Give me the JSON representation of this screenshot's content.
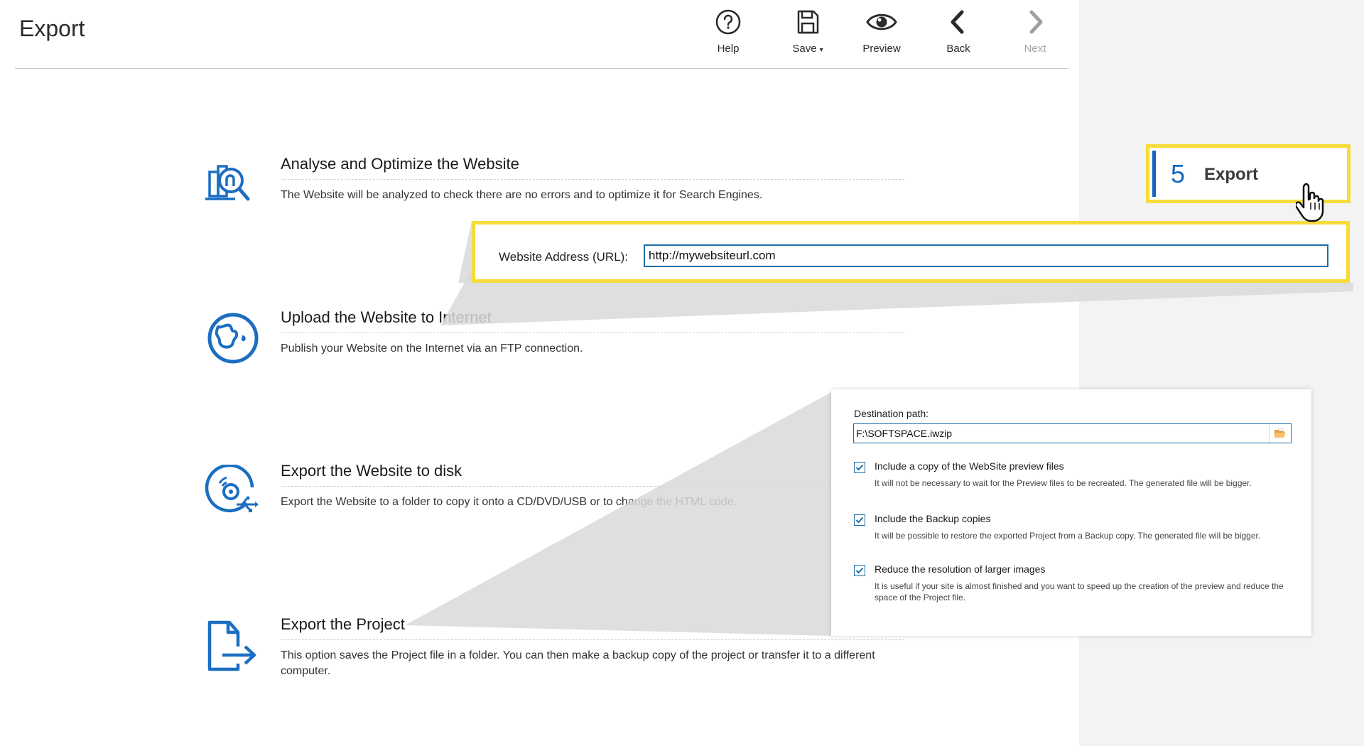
{
  "page": {
    "title": "Export"
  },
  "toolbar": {
    "help_label": "Help",
    "save_label": "Save",
    "save_caret": "▾",
    "preview_label": "Preview",
    "back_label": "Back",
    "next_label": "Next"
  },
  "options": [
    {
      "title": "Analyse and Optimize the Website",
      "description": "The Website will be analyzed to check there are no errors and to optimize it for Search Engines.",
      "icon": "analyse-icon"
    },
    {
      "title": "Upload the Website to Internet",
      "description": "Publish your Website on the Internet via an FTP connection.",
      "icon": "globe-icon"
    },
    {
      "title": "Export the Website to disk",
      "description": "Export the Website to a folder to copy it onto a CD/DVD/USB or to change the HTML code.",
      "icon": "disc-usb-icon"
    },
    {
      "title": "Export the Project",
      "description": "This option saves the Project file in a folder.  You can then make a backup copy of the project or transfer it to a different computer.",
      "icon": "file-export-icon"
    }
  ],
  "url_panel": {
    "label": "Website Address (URL):",
    "value": "http://mywebsiteurl.com"
  },
  "step": {
    "number": "5",
    "label": "Export"
  },
  "dest_panel": {
    "label": "Destination path:",
    "value": "F:\\SOFTSPACE.iwzip",
    "checkboxes": [
      {
        "label": "Include a copy of the WebSite preview files",
        "note": "It will not be necessary to wait for the Preview files to be recreated. The generated file will be bigger.",
        "checked": true
      },
      {
        "label": "Include the Backup copies",
        "note": "It will be possible to restore the exported Project from a Backup copy. The generated file will be bigger.",
        "checked": true
      },
      {
        "label": "Reduce the resolution of larger images",
        "note": "It is useful if your site is almost finished and you want to speed up the creation of the preview and reduce the space of the Project file.",
        "checked": true
      }
    ]
  },
  "colors": {
    "accent": "#1565c0",
    "highlight": "#f5dc3a",
    "sidebar": "#f3f3f3"
  }
}
